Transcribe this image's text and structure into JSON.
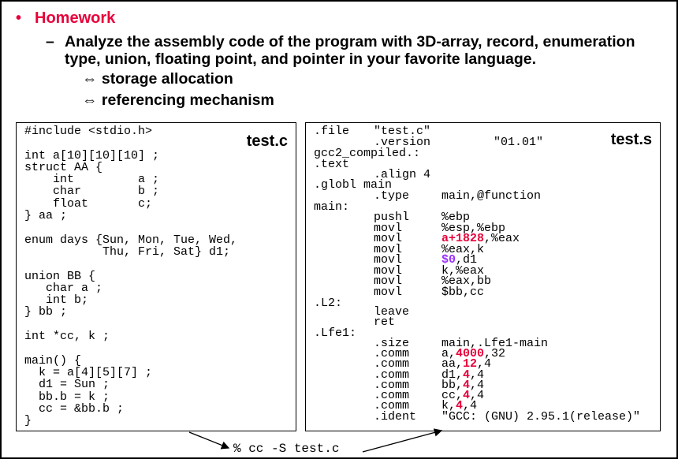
{
  "homework": {
    "bullet": "•",
    "title": "Homework",
    "dash": "–",
    "analyze_line1": "Analyze the assembly code of the program with 3D-array, record, enumeration",
    "analyze_line2": "type, union, floating point, and pointer in your favorite language.",
    "arrow_symbol": "⇔",
    "item1": "storage allocation",
    "item2": "referencing mechanism"
  },
  "test_c": {
    "filename": "test.c",
    "lines": [
      "#include <stdio.h>",
      "",
      "int a[10][10][10] ;",
      "struct AA {",
      "    int         a ;",
      "    char        b ;",
      "    float       c;",
      "} aa ;",
      "",
      "enum days {Sun, Mon, Tue, Wed,",
      "           Thu, Fri, Sat} d1;",
      "",
      "union BB {",
      "   char a ;",
      "   int b;",
      "} bb ;",
      "",
      "int *cc, k ;",
      "",
      "main() {",
      "  k = a[4][5][7] ;",
      "  d1 = Sun ;",
      "  bb.b = k ;",
      "  cc = &bb.b ;",
      "}"
    ]
  },
  "test_s": {
    "filename": "test.s",
    "file_directive": ".file",
    "file_value": "\"test.c\"",
    "version_directive": ".version",
    "version_value": "\"01.01\"",
    "gcc_compiled": "gcc2_compiled.:",
    "text": ".text",
    "align": ".align 4",
    "globl": ".globl main",
    "type_directive": ".type",
    "type_value": "main,@function",
    "main_label": "main:",
    "instr": [
      {
        "op": "pushl",
        "a1": "%ebp",
        "a2": ""
      },
      {
        "op": "movl",
        "a1": "%esp,%ebp",
        "a2": ""
      },
      {
        "op": "movl",
        "hl": "a+1828",
        "rest": ",%eax"
      },
      {
        "op": "movl",
        "a1": "%eax,k",
        "a2": ""
      },
      {
        "op": "movl",
        "hlp": "$0",
        "rest": ",d1"
      },
      {
        "op": "movl",
        "a1": "k,%eax",
        "a2": ""
      },
      {
        "op": "movl",
        "a1": "%eax,bb",
        "a2": ""
      },
      {
        "op": "movl",
        "a1": "$bb,cc",
        "a2": ""
      }
    ],
    "l2_label": ".L2:",
    "leave": "leave",
    "ret": "ret",
    "lfe1_label": ".Lfe1:",
    "size_directive": ".size",
    "size_value": "main,.Lfe1-main",
    "comm": [
      {
        "dir": ".comm",
        "pre": "a,",
        "hl": "4000",
        "post": ",32"
      },
      {
        "dir": ".comm",
        "pre": "aa,",
        "hl": "12",
        "post": ",4"
      },
      {
        "dir": ".comm",
        "pre": "d1,",
        "hl": "4",
        "post": ",4"
      },
      {
        "dir": ".comm",
        "pre": "bb,",
        "hl": "4",
        "post": ",4"
      },
      {
        "dir": ".comm",
        "pre": "cc,",
        "hl": "4",
        "post": ",4"
      },
      {
        "dir": ".comm",
        "pre": "k,",
        "hl": "4",
        "post": ",4"
      }
    ],
    "ident_directive": ".ident",
    "ident_value": "\"GCC: (GNU) 2.95.1(release)\""
  },
  "command": "% cc -S test.c"
}
